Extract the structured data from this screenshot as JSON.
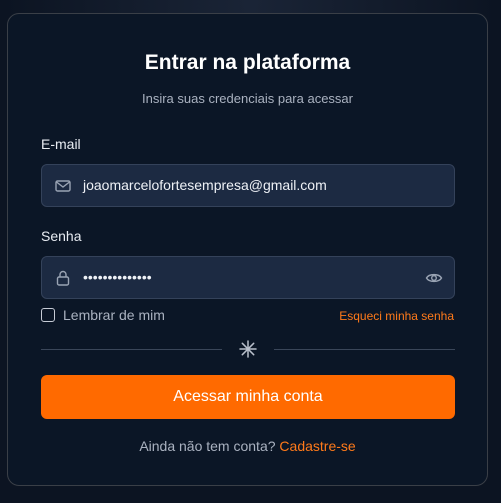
{
  "header": {
    "title": "Entrar na plataforma",
    "subtitle": "Insira suas credenciais para acessar"
  },
  "email": {
    "label": "E-mail",
    "value": "joaomarcelofortesempresa@gmail.com",
    "icon": "mail-icon"
  },
  "password": {
    "label": "Senha",
    "value": "••••••••••••••",
    "icon": "lock-icon",
    "toggle_icon": "eye-icon"
  },
  "options": {
    "remember_label": "Lembrar de mim",
    "remember_checked": false,
    "forgot_label": "Esqueci minha senha"
  },
  "divider": {
    "icon": "sparkle-icon"
  },
  "submit": {
    "label": "Acessar minha conta"
  },
  "footer": {
    "prompt": "Ainda não tem conta?",
    "signup_label": "Cadastre-se"
  },
  "colors": {
    "accent": "#ff6a00",
    "link": "#ff7a1a",
    "card_bg": "#0b1626",
    "input_bg": "#1c2a42"
  }
}
